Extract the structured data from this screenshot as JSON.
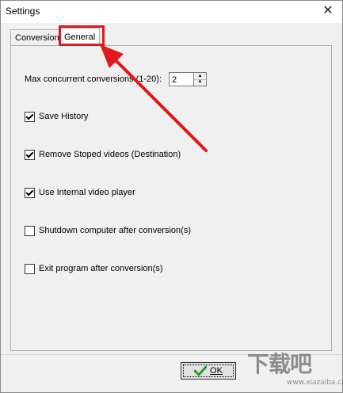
{
  "window": {
    "title": "Settings",
    "close_icon": "close-icon"
  },
  "tabs": [
    {
      "label": "Conversion",
      "active": false
    },
    {
      "label": "General",
      "active": true
    }
  ],
  "general": {
    "max_concurrent_label": "Max concurrent conversions (1-20):",
    "max_concurrent_value": "2",
    "options": [
      {
        "label": "Save History",
        "checked": true
      },
      {
        "label": "Remove Stoped videos (Destination)",
        "checked": true
      },
      {
        "label": "Use Internal video player",
        "checked": true
      },
      {
        "label": "Shutdown computer after conversion(s)",
        "checked": false
      },
      {
        "label": "Exit program after conversion(s)",
        "checked": false
      }
    ]
  },
  "footer": {
    "ok_label": "OK",
    "ok_icon": "checkmark-icon"
  },
  "annotation": {
    "color": "#e0191c"
  },
  "watermark": {
    "main": "下载吧",
    "sub": "www.xiazaiba.com"
  }
}
